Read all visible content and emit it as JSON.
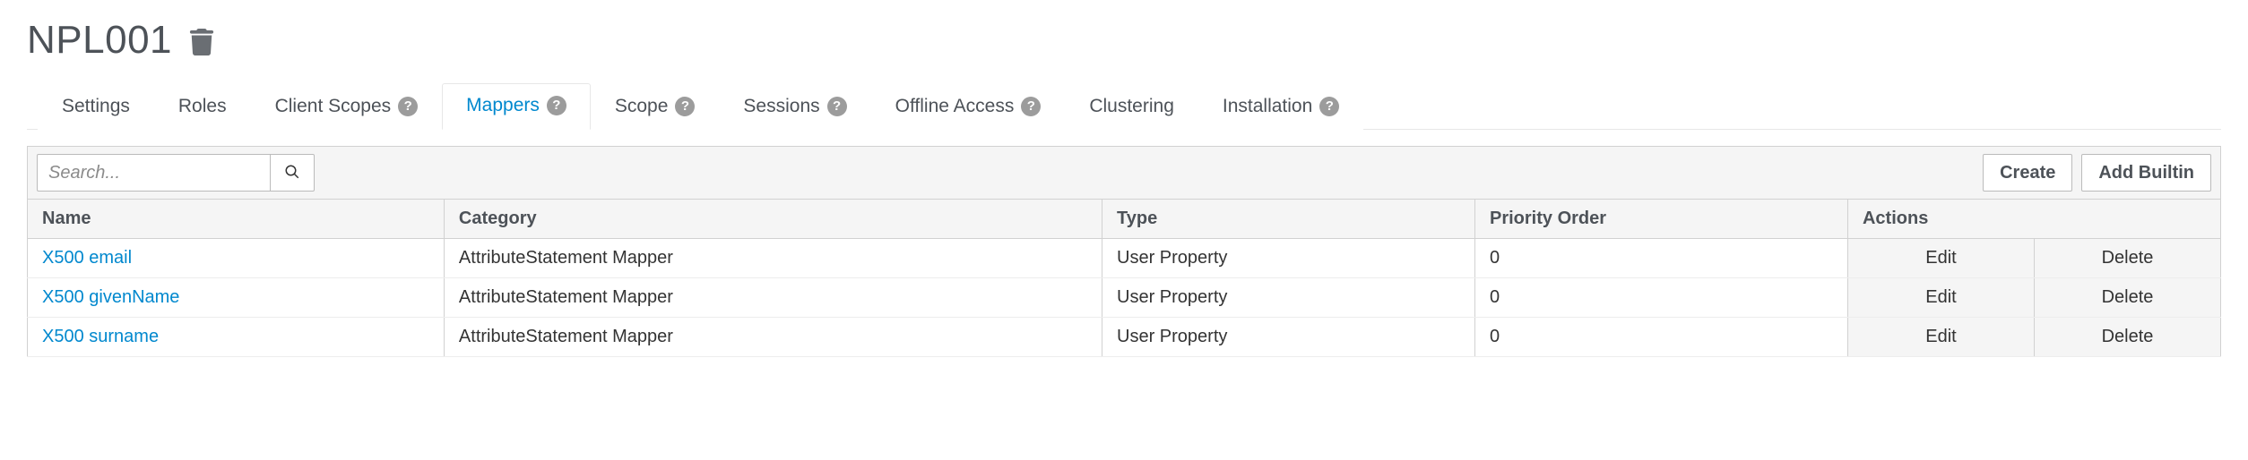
{
  "header": {
    "title": "NPL001"
  },
  "tabs": [
    {
      "label": "Settings",
      "help": false,
      "active": false
    },
    {
      "label": "Roles",
      "help": false,
      "active": false
    },
    {
      "label": "Client Scopes",
      "help": true,
      "active": false
    },
    {
      "label": "Mappers",
      "help": true,
      "active": true
    },
    {
      "label": "Scope",
      "help": true,
      "active": false
    },
    {
      "label": "Sessions",
      "help": true,
      "active": false
    },
    {
      "label": "Offline Access",
      "help": true,
      "active": false
    },
    {
      "label": "Clustering",
      "help": false,
      "active": false
    },
    {
      "label": "Installation",
      "help": true,
      "active": false
    }
  ],
  "toolbar": {
    "search_placeholder": "Search...",
    "create_label": "Create",
    "add_builtin_label": "Add Builtin"
  },
  "table": {
    "columns": {
      "name": "Name",
      "category": "Category",
      "type": "Type",
      "priority": "Priority Order",
      "actions": "Actions"
    },
    "actions": {
      "edit": "Edit",
      "delete": "Delete"
    },
    "rows": [
      {
        "name": "X500 email",
        "category": "AttributeStatement Mapper",
        "type": "User Property",
        "priority": "0"
      },
      {
        "name": "X500 givenName",
        "category": "AttributeStatement Mapper",
        "type": "User Property",
        "priority": "0"
      },
      {
        "name": "X500 surname",
        "category": "AttributeStatement Mapper",
        "type": "User Property",
        "priority": "0"
      }
    ]
  }
}
